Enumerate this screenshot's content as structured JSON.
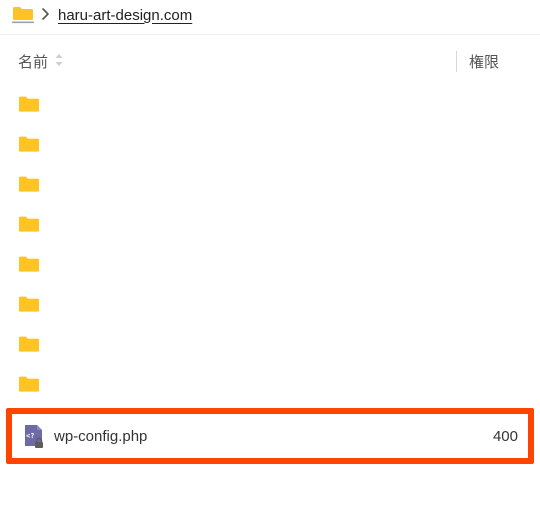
{
  "breadcrumb": {
    "domain": "haru-art-design.com"
  },
  "columns": {
    "name_label": "名前",
    "perm_label": "権限"
  },
  "rows": [
    {
      "type": "folder",
      "name": "",
      "perm": ""
    },
    {
      "type": "folder",
      "name": "",
      "perm": ""
    },
    {
      "type": "folder",
      "name": "",
      "perm": ""
    },
    {
      "type": "folder",
      "name": "",
      "perm": ""
    },
    {
      "type": "folder",
      "name": "",
      "perm": ""
    },
    {
      "type": "folder",
      "name": "",
      "perm": ""
    },
    {
      "type": "folder",
      "name": "",
      "perm": ""
    },
    {
      "type": "folder",
      "name": "",
      "perm": ""
    }
  ],
  "highlighted": {
    "name": "wp-config.php",
    "perm": "400"
  }
}
